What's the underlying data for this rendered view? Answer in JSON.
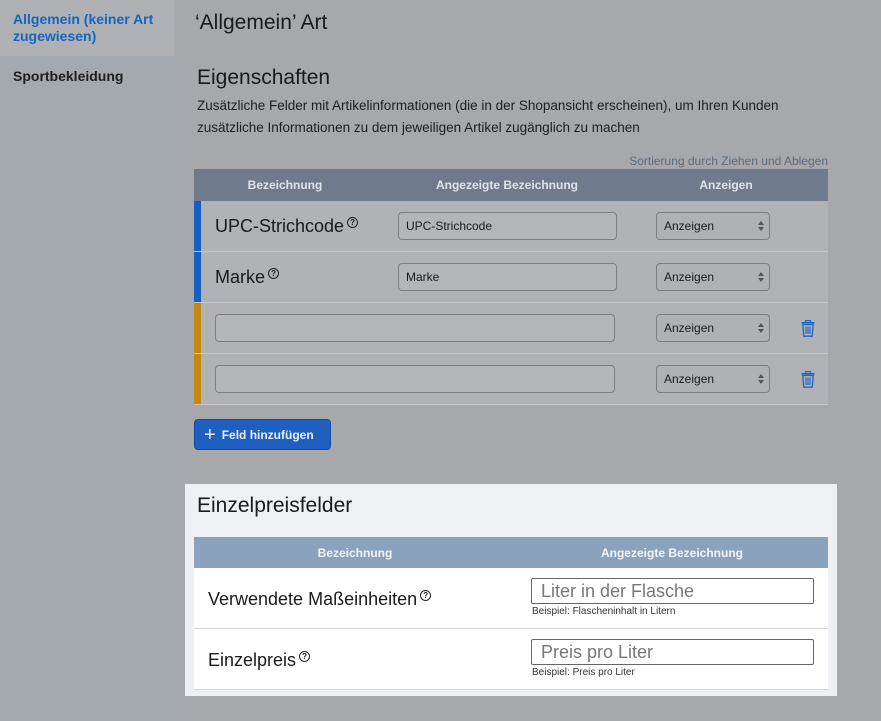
{
  "sidebar": {
    "items": [
      {
        "label": "Allgemein (keiner Art zugewiesen)",
        "active": true
      },
      {
        "label": "Sportbekleidung",
        "active": false
      }
    ]
  },
  "page": {
    "title": "‘Allgemein’ Art"
  },
  "properties": {
    "title": "Eigenschaften",
    "description": "Zusätzliche Felder mit Artikelinformationen (die in der Shopansicht erscheinen), um Ihren Kunden zusätzliche Informationen zu dem jeweiligen Artikel zugänglich zu machen",
    "sort_hint": "Sortierung durch Ziehen und Ablegen",
    "columns": [
      "Bezeichnung",
      "Angezeigte Bezeichnung",
      "Anzeigen"
    ],
    "rows": [
      {
        "label": "UPC-Strichcode",
        "display_value": "UPC-Strichcode",
        "show": "Anzeigen",
        "type": "system"
      },
      {
        "label": "Marke",
        "display_value": "Marke",
        "show": "Anzeigen",
        "type": "system"
      },
      {
        "label": "",
        "display_value": "",
        "show": "Anzeigen",
        "type": "custom"
      },
      {
        "label": "",
        "display_value": "",
        "show": "Anzeigen",
        "type": "custom"
      }
    ],
    "add_button": "Feld hinzufügen",
    "help_icon": "?",
    "trash_icon": "trash-icon"
  },
  "unit_price": {
    "title": "Einzelpreisfelder",
    "columns": [
      "Bezeichnung",
      "Angezeigte Bezeichnung"
    ],
    "rows": [
      {
        "label": "Verwendete Maßeinheiten",
        "placeholder": "Liter in der Flasche",
        "hint": "Beispiel: Flascheninhalt in Litern"
      },
      {
        "label": "Einzelpreis",
        "placeholder": "Preis pro Liter",
        "hint": "Beispiel: Preis pro Liter"
      }
    ]
  },
  "colors": {
    "accent": "#1565c0",
    "system_bar": "#1760c2",
    "custom_bar": "#c28a13",
    "panel_bg": "#eef0f3"
  }
}
